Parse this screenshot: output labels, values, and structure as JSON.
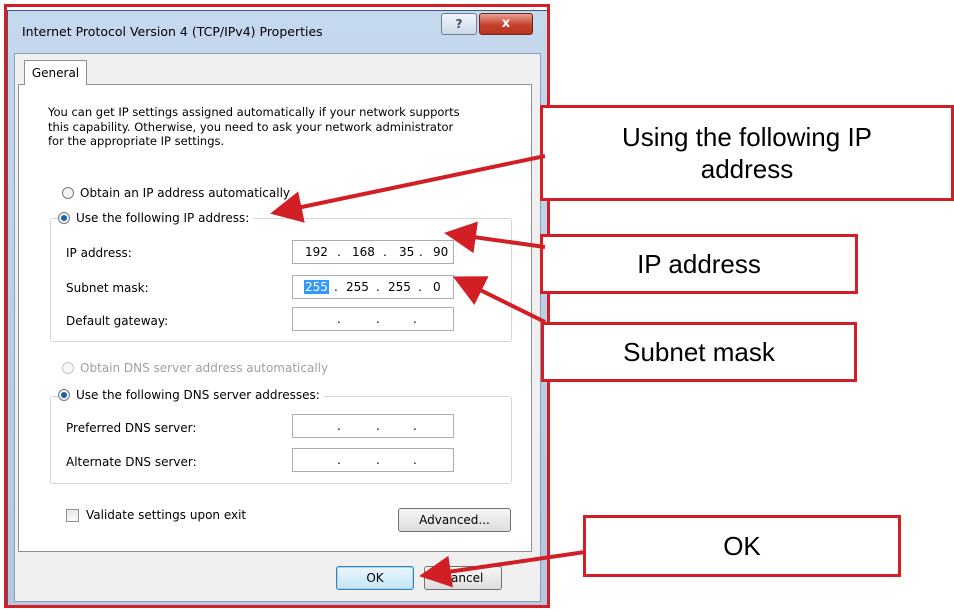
{
  "window": {
    "title": "Internet Protocol Version 4 (TCP/IPv4) Properties",
    "help_label": "?",
    "close_label": "x"
  },
  "tabs": [
    {
      "label": "General"
    }
  ],
  "description": "You can get IP settings assigned automatically if your network supports\nthis capability. Otherwise, you need to ask your network administrator\nfor the appropriate IP settings.",
  "ip_settings": {
    "auto_label": "Obtain an IP address automatically",
    "manual_label": "Use the following IP address:",
    "selected": "manual",
    "fields": [
      {
        "label": "IP address:",
        "octets": [
          "192",
          "168",
          "35",
          "90"
        ]
      },
      {
        "label": "Subnet mask:",
        "octets": [
          "255",
          "255",
          "255",
          "0"
        ],
        "selected_octet": 0
      },
      {
        "label": "Default gateway:",
        "octets": [
          "",
          "",
          "",
          ""
        ]
      }
    ]
  },
  "dns_settings": {
    "auto_label": "Obtain DNS server address automatically",
    "manual_label": "Use the following DNS server addresses:",
    "selected": "manual",
    "fields": [
      {
        "label": "Preferred DNS server:",
        "octets": [
          "",
          "",
          "",
          ""
        ]
      },
      {
        "label": "Alternate DNS server:",
        "octets": [
          "",
          "",
          "",
          ""
        ]
      }
    ]
  },
  "validate_label": "Validate settings upon exit",
  "validate_checked": false,
  "buttons": {
    "advanced": "Advanced...",
    "ok": "OK",
    "cancel": "Cancel"
  },
  "callouts": {
    "ip_option": "Using the following IP address",
    "ip_address": "IP address",
    "subnet_mask": "Subnet mask",
    "ok": "OK"
  },
  "colors": {
    "annotation_red": "#d21f26",
    "selection_blue": "#3399ff",
    "radio_blue": "#1d5fb3"
  }
}
